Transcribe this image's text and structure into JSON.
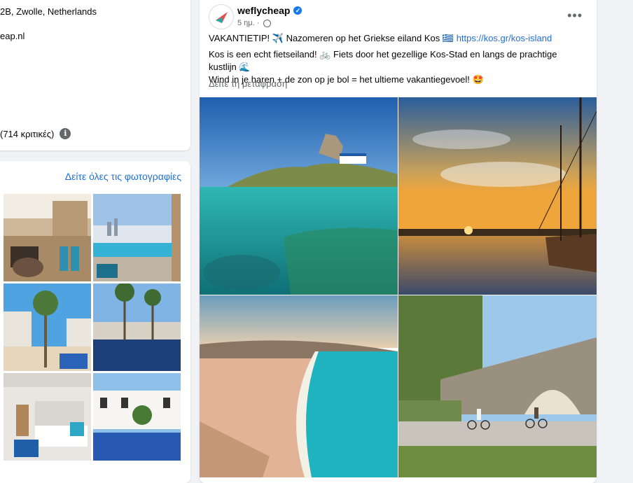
{
  "about": {
    "address": "2B, Zwolle, Netherlands",
    "website": "eap.nl",
    "reviews": "(714 κριτικές)"
  },
  "photos": {
    "see_all_label": "Δείτε όλες τις φωτογραφίες"
  },
  "post": {
    "page_name": "weflycheap",
    "verified_icon": "verified-badge-icon",
    "time": "5 ημ.",
    "line1_prefix": "VAKANTIETIP! ✈️ Nazomeren op het Griekse eiland Kos 🇬🇷",
    "link": "https://kos.gr/kos-island",
    "line2": "Kos is een echt fietseiland! 🚲 Fiets door het gezellige Kos-Stad en langs de prachtige kustlijn 🌊",
    "line3": "Wind in je haren + de zon op je bol = het ultieme vakantiegevoel! 🤩",
    "translate_label": "Δείτε τη μετάφραση",
    "more_label": "•••"
  },
  "colors": {
    "link": "#216fdb",
    "accent": "#1877f2",
    "muted": "#65676b"
  }
}
